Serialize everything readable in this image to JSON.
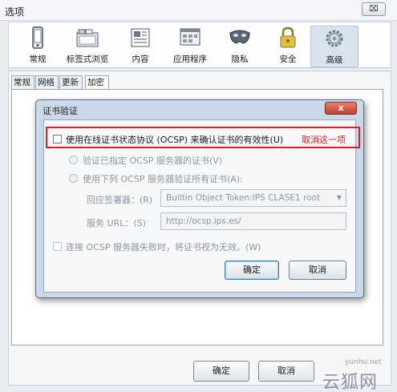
{
  "window": {
    "title": "选项",
    "close_symbol": "⌧"
  },
  "toolbar": {
    "items": [
      {
        "label": "常规",
        "icon": "phone-icon"
      },
      {
        "label": "标签式浏览",
        "icon": "tabs-icon"
      },
      {
        "label": "内容",
        "icon": "content-icon"
      },
      {
        "label": "应用程序",
        "icon": "applications-icon"
      },
      {
        "label": "隐私",
        "icon": "mask-icon"
      },
      {
        "label": "安全",
        "icon": "lock-icon"
      },
      {
        "label": "高级",
        "icon": "gear-icon",
        "active": true
      }
    ]
  },
  "subtabs": [
    "常规",
    "网络",
    "更新",
    "加密"
  ],
  "dialog": {
    "title": "证书验证",
    "close_symbol": "x",
    "ocsp_checkbox": "使用在线证书状态协议 (OCSP) 来确认证书的有效性(U)",
    "radio_specified": "验证已指定 OCSP 服务器的证书(V)",
    "radio_all": "使用下列 OCSP 服务器验证所有证书(A):",
    "responder_label": "回应签署器：(R)",
    "responder_value": "Builtin Object Token:IPS CLASE1 root",
    "url_label": "服务 URL：(S)",
    "url_value": "http://ocsp.ips.es/",
    "fail_checkbox": "连接 OCSP 服务器失败时，将证书视为无效。(W)",
    "ok": "确定",
    "cancel": "取消"
  },
  "annotation": {
    "note": "取消这一项",
    "color": "#d42020"
  },
  "bottom_buttons": {
    "ok": "确定",
    "cancel": "取消"
  },
  "watermark": {
    "url": "yunhu.net",
    "brand": "云狐网"
  }
}
